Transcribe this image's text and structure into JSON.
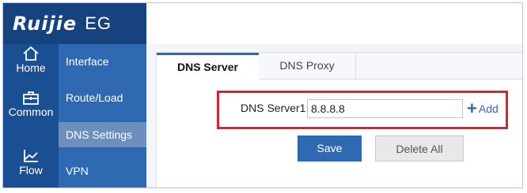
{
  "brand": {
    "logo": "Ruijie",
    "product": "EG"
  },
  "rail": [
    {
      "label": "Home",
      "icon": "home-icon"
    },
    {
      "label": "Common",
      "icon": "toolbox-icon"
    },
    {
      "label": "Flow",
      "icon": "flow-chart-icon"
    }
  ],
  "submenu": [
    {
      "label": "Interface"
    },
    {
      "label": "Route/Load"
    },
    {
      "label": "DNS Settings",
      "active": true
    },
    {
      "label": "VPN"
    }
  ],
  "tabs": [
    {
      "label": "DNS Server",
      "active": true
    },
    {
      "label": "DNS Proxy",
      "active": false
    }
  ],
  "form": {
    "dns_server1_label": "DNS Server1:",
    "dns_server1_value": "8.8.8.8",
    "add_label": "Add"
  },
  "actions": {
    "save_label": "Save",
    "delete_all_label": "Delete All"
  },
  "colors": {
    "brand_bg": "#16427e",
    "rail_bg": "#1b4f93",
    "submenu_bg": "#2e69b1",
    "submenu_active": "#6c8fbe",
    "accent": "#2e69b1",
    "highlight": "#d9232f"
  }
}
